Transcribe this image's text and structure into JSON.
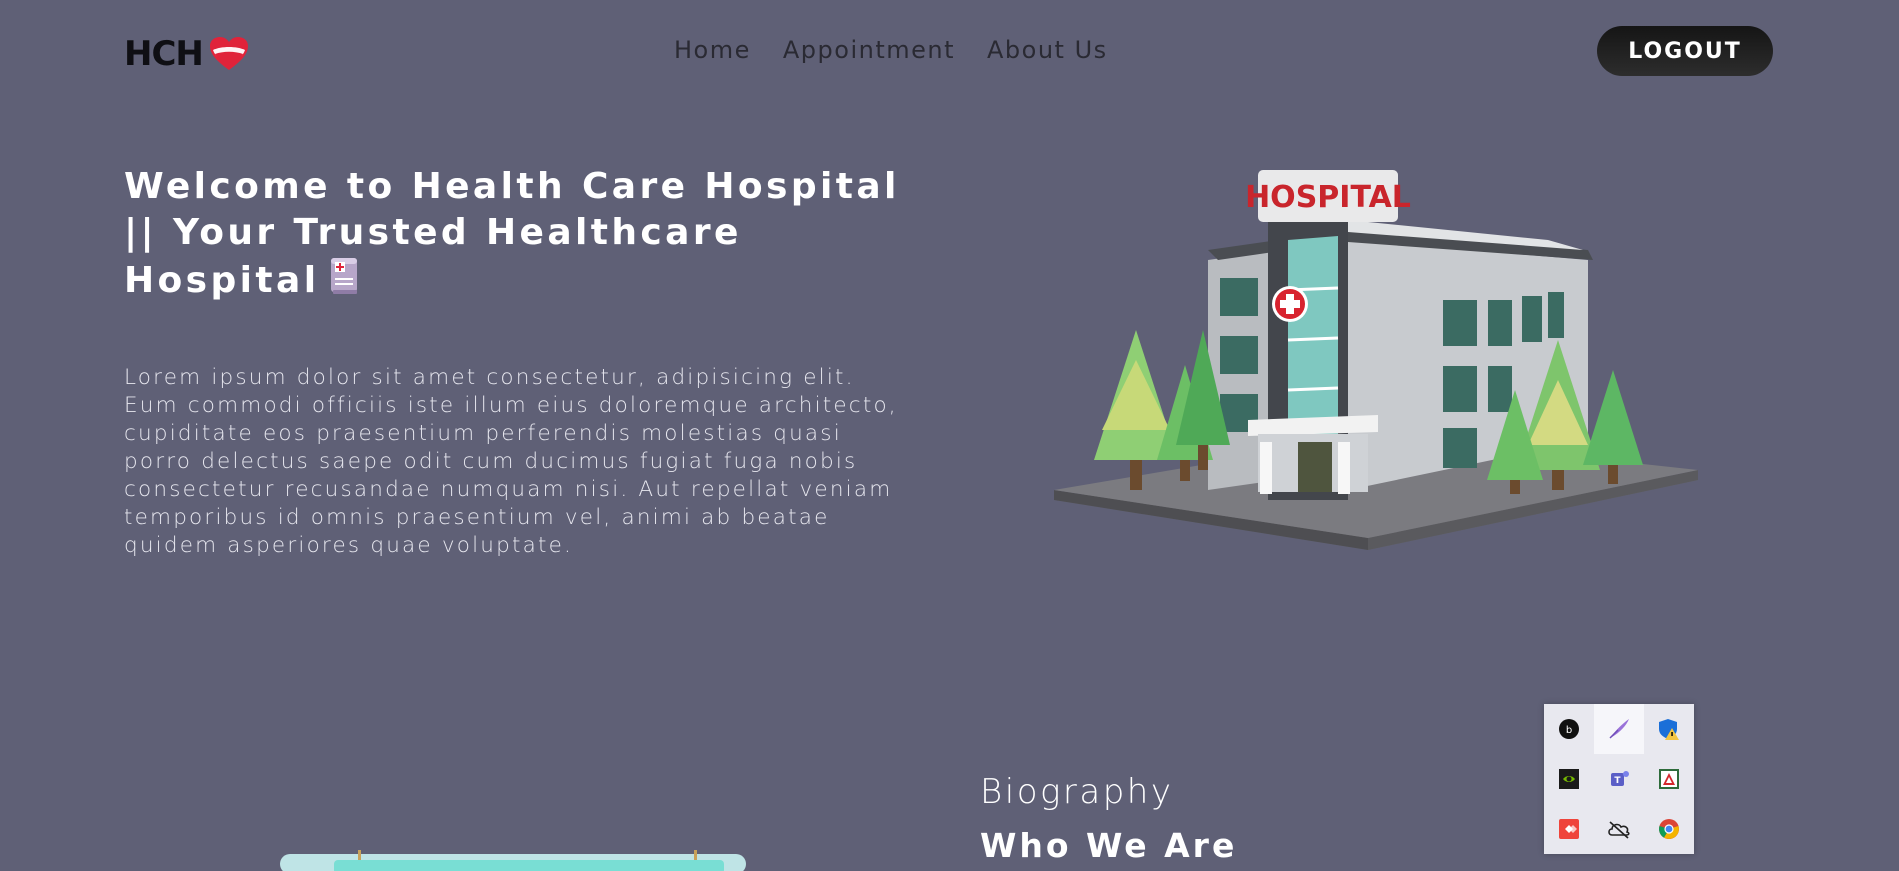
{
  "header": {
    "logo_text": "HCH",
    "nav": [
      "Home",
      "Appointment",
      "About Us"
    ],
    "logout_label": "LOGOUT"
  },
  "hero": {
    "title": "Welcome to Health Care Hospital || Your Trusted Healthcare Hospital",
    "body": "Lorem ipsum dolor sit amet consectetur, adipisicing elit. Eum commodi officiis iste illum eius doloremque architecto, cupiditate eos praesentium perferendis molestias quasi porro delectus saepe odit cum ducimus fugiat fuga nobis consectetur recusandae numquam nisi. Aut repellat veniam temporibus id omnis praesentium vel, animi ab beatae quidem asperiores quae voluptate.",
    "sign_text": "HOSPITAL"
  },
  "biography": {
    "label": "Biography",
    "title": "Who We Are"
  },
  "tray": {
    "icons": [
      "bitwarden-icon",
      "quill-icon",
      "security-warning-icon",
      "nvidia-icon",
      "teams-icon",
      "adobe-icon",
      "anydesk-icon",
      "cloud-off-icon",
      "chrome-icon"
    ]
  },
  "colors": {
    "background": "#5f6076",
    "heart": "#e0233a",
    "logout_bg": "#1c1c1c"
  }
}
